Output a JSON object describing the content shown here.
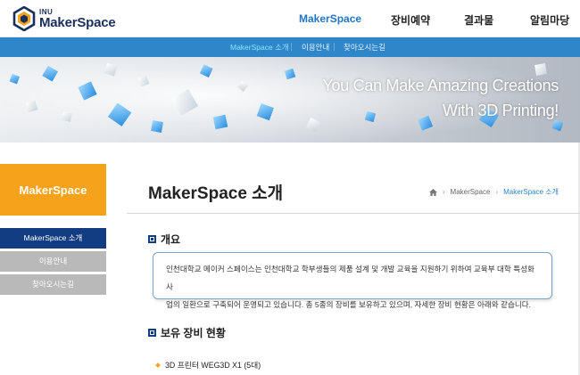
{
  "brand": {
    "top": "INU",
    "name": "MakerSpace"
  },
  "gnb": {
    "items": [
      {
        "label": "MakerSpace",
        "active": true
      },
      {
        "label": "장비예약",
        "active": false
      },
      {
        "label": "결과물",
        "active": false
      },
      {
        "label": "알림마당",
        "active": false
      }
    ]
  },
  "subnav": {
    "items": [
      {
        "label": "MakerSpace 소개",
        "active": true
      },
      {
        "label": "이용안내",
        "active": false
      },
      {
        "label": "찾아오시는길",
        "active": false
      }
    ]
  },
  "banner": {
    "line1": "You Can Make Amazing Creations",
    "line2": "With 3D Printing!"
  },
  "sidebar": {
    "title": "MakerSpace",
    "items": [
      {
        "label": "MakerSpace 소개",
        "active": true
      },
      {
        "label": "이용안내",
        "active": false
      },
      {
        "label": "찾아오시는길",
        "active": false
      }
    ]
  },
  "main": {
    "title": "MakerSpace 소개",
    "breadcrumb": [
      "MakerSpace",
      "MakerSpace 소개"
    ],
    "overview_heading": "개요",
    "overview_line1": "인천대학교 메이커 스페이스는 인천대학교 학부생들의 제품 설계 및 개발 교육을 지원하기 위하여 교육부 대학 특성화 사",
    "overview_line2": "업의 일환으로 구축되어 운영되고 있습니다. 총 5종의 장비를 보유하고 있으며, 자세한 장비 현황은 아래와 같습니다.",
    "equipment_heading": "보유 장비 현황",
    "equipment_first": "3D 프린터 WEG3D X1 (5대)"
  },
  "colors": {
    "accent_blue": "#2f86c8",
    "navy": "#123d82",
    "orange": "#f7a21b",
    "inactive_gray": "#b9b9b9"
  }
}
